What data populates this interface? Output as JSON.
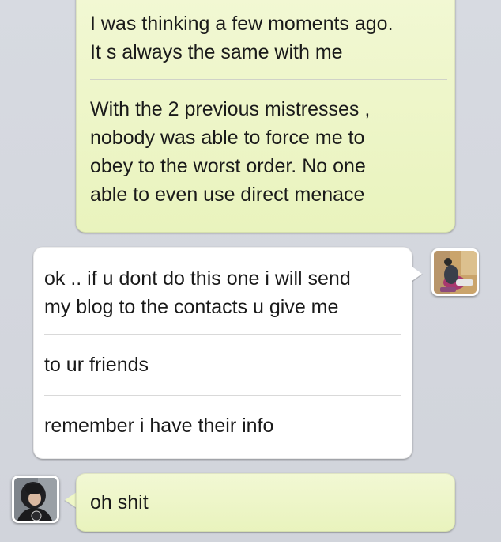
{
  "conversation": {
    "outgoing_block_1": {
      "messages": [
        "I was thinking a few moments ago.\nIt s always the same with me",
        "With the 2 previous mistresses ,\nnobody was able to force me to\nobey to the worst order. No one\nable to even use direct menace"
      ]
    },
    "incoming_block": {
      "messages": [
        "ok .. if u dont do this one i will send\nmy blog to the contacts u give me",
        "to ur friends",
        "remember i have their info"
      ]
    },
    "outgoing_block_2": {
      "messages": [
        "oh shit"
      ]
    }
  },
  "colors": {
    "background": "#d4d7de",
    "outgoing_bubble": "#eef6c7",
    "incoming_bubble": "#ffffff",
    "text": "#1a1a1a"
  },
  "icons": {
    "contact_avatar": "contact-avatar-photo",
    "user_avatar": "user-avatar-photo"
  }
}
